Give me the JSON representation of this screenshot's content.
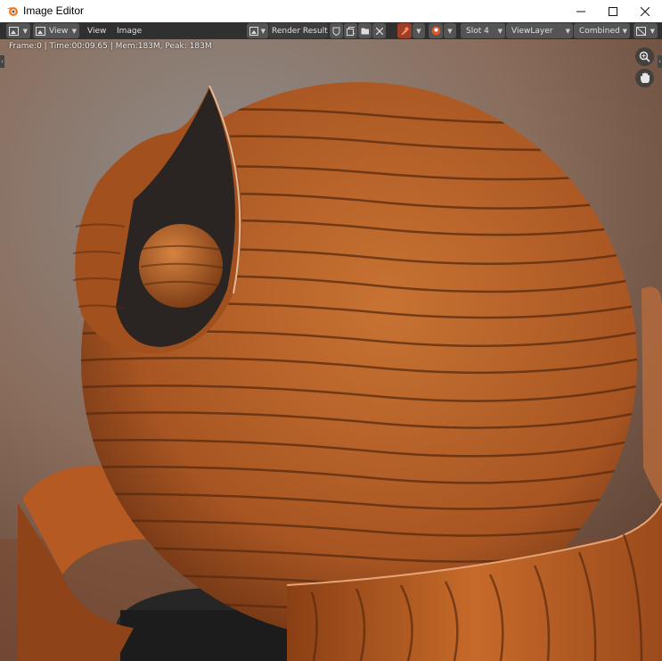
{
  "window": {
    "title": "Image Editor"
  },
  "toolbar": {
    "view_menu_label": "View",
    "view_label": "View",
    "image_label": "Image",
    "image_name": "Render Result",
    "slot": "Slot 4",
    "view_layer": "ViewLayer",
    "pass": "Combined"
  },
  "status": {
    "text": "Frame:0 | Time:00:09.65 | Mem:183M, Peak: 183M"
  },
  "colors": {
    "wood": "#c06a2a",
    "wood_dark": "#5a2a0e",
    "toolbar": "#303030",
    "accent": "#e0552b"
  }
}
